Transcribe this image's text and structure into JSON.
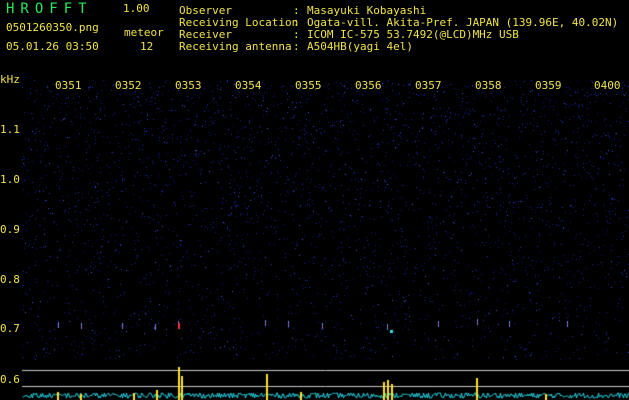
{
  "header": {
    "app_title": "HROFFT",
    "app_version": "1.00",
    "file_name": "0501260350.png",
    "date_time": "05.01.26 03:50",
    "count_label": "meteor",
    "count_value": "12"
  },
  "station": {
    "rows": [
      {
        "label": "Observer",
        "sep": ":",
        "value": "Masayuki Kobayashi"
      },
      {
        "label": "Receiving Location",
        "sep": ":",
        "value": "Ogata-vill. Akita-Pref. JAPAN (139.96E, 40.02N)"
      },
      {
        "label": "Receiver",
        "sep": ":",
        "value": "ICOM IC-575 53.7492(@LCD)MHz USB"
      },
      {
        "label": "Receiving antenna",
        "sep": ":",
        "value": "A504HB(yagi 4el)"
      }
    ]
  },
  "axes": {
    "y_unit": "kHz",
    "y_ticks": [
      "1.1",
      "1.0",
      "0.9",
      "0.8",
      "0.7",
      "0.6"
    ],
    "x_ticks": [
      "0351",
      "0352",
      "0353",
      "0354",
      "0355",
      "0356",
      "0357",
      "0358",
      "0359",
      "0400"
    ]
  },
  "colors": {
    "background": "#000000",
    "text": "#f0e24a",
    "title": "#27e85a",
    "noise": "#2030c8",
    "level_trace": "#28d8e8",
    "level_spike": "#ffe020",
    "guide_line": "#c8c8c8"
  }
}
